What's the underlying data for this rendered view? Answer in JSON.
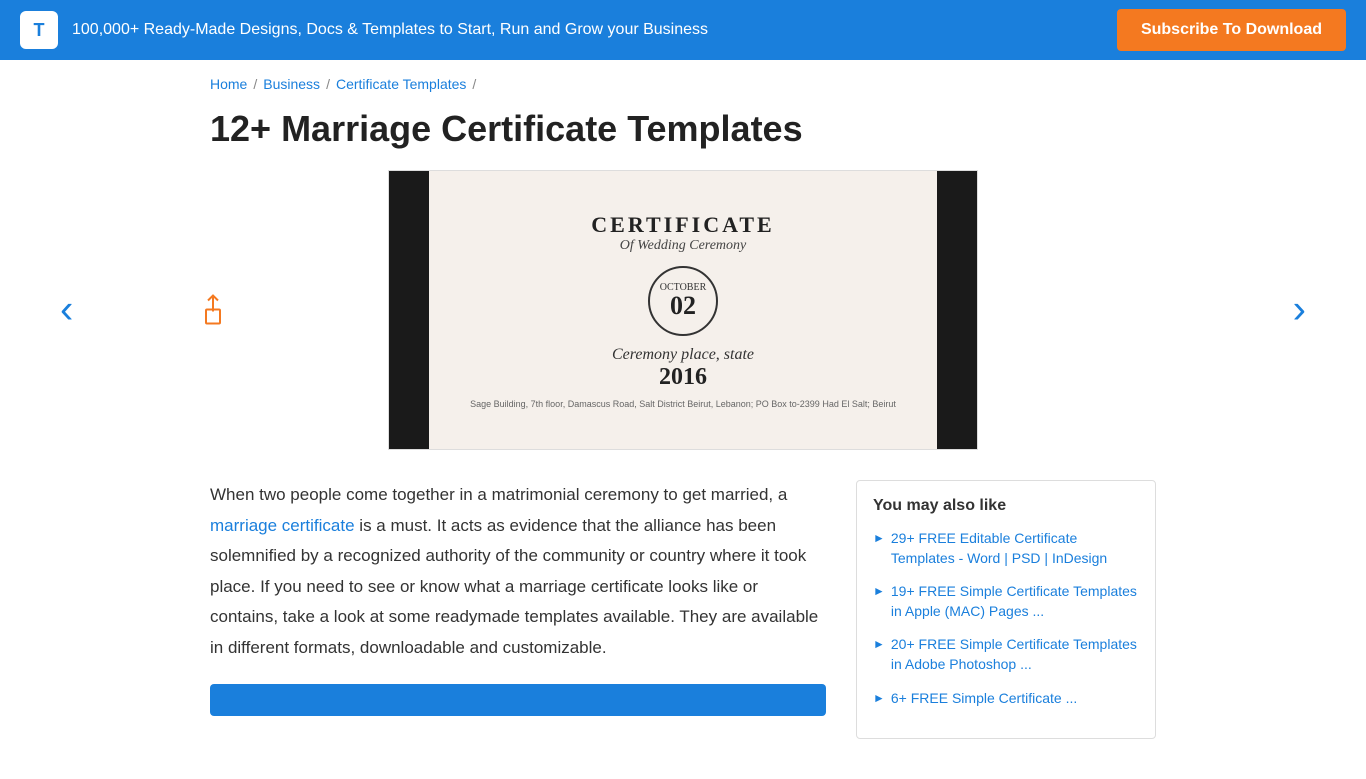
{
  "header": {
    "logo_text": "T",
    "tagline": "100,000+ Ready-Made Designs, Docs & Templates to Start, Run and Grow your Business",
    "subscribe_label": "Subscribe To Download"
  },
  "breadcrumb": {
    "items": [
      {
        "label": "Home",
        "href": "#"
      },
      {
        "label": "Business",
        "href": "#"
      },
      {
        "label": "Certificate Templates",
        "href": "#"
      }
    ]
  },
  "page_title": "12+ Marriage Certificate Templates",
  "certificate": {
    "title": "CERTIFICATE",
    "subtitle": "Of Wedding Ceremony",
    "month": "OCTOBER",
    "day": "02",
    "place": "Ceremony place, state",
    "year": "2016",
    "address": "Sage Building, 7th floor, Damascus Road, Salt District Beirut, Lebanon; PO Box to-2399 Had El Salt; Beirut"
  },
  "main_text": {
    "part1": "When two people come together in a matrimonial ceremony to get married, a ",
    "link_text": "marriage certificate",
    "part2": " is a must. It acts as evidence that the alliance has been solemnified by a recognized authority of the community or country where it took place. If you need to see or know what a marriage certificate looks like or contains, take a look at some readymade templates available. They are available in different formats, downloadable and customizable."
  },
  "sidebar": {
    "title": "You may also like",
    "links": [
      {
        "label": "29+ FREE Editable Certificate Templates - Word | PSD | InDesign"
      },
      {
        "label": "19+ FREE Simple Certificate Templates in Apple (MAC) Pages ..."
      },
      {
        "label": "20+ FREE Simple Certificate Templates in Adobe Photoshop ..."
      },
      {
        "label": "6+ FREE Simple Certificate ..."
      }
    ]
  }
}
